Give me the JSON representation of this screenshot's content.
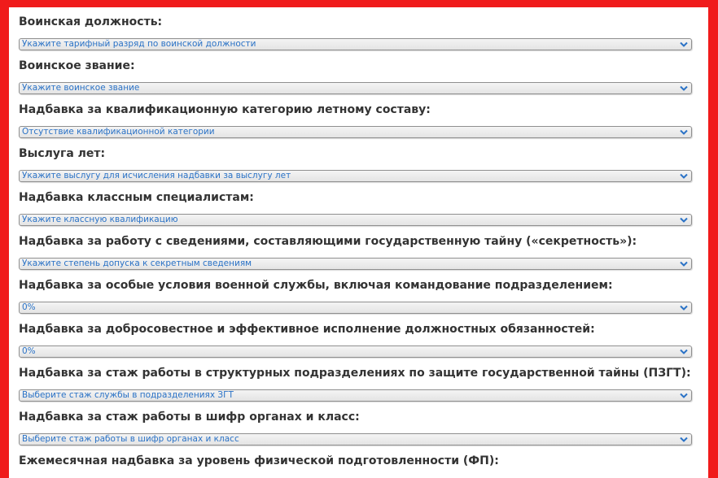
{
  "accent_color": "#f01b1b",
  "value_color": "#2a72c6",
  "fields": [
    {
      "label": "Воинская должность:",
      "value": "Укажите тарифный разряд по воинской должности",
      "icon": "chevron-down-icon"
    },
    {
      "label": "Воинское звание:",
      "value": "Укажите воинское звание",
      "icon": "chevron-down-icon"
    },
    {
      "label": "Надбавка за квалификационную категорию летному составу:",
      "value": "Отсутствие квалификационной категории",
      "icon": "chevron-down-icon"
    },
    {
      "label": "Выслуга лет:",
      "value": "Укажите выслугу для исчисления надбавки за выслугу лет",
      "icon": "chevron-down-icon"
    },
    {
      "label": "Надбавка классным специалистам:",
      "value": "Укажите классную квалификацию",
      "icon": "chevron-down-icon"
    },
    {
      "label": "Надбавка за работу с сведениями, составляющими государственную тайну («секретность»):",
      "value": "Укажите степень допуска к секретным сведениям",
      "icon": "chevron-down-icon"
    },
    {
      "label": "Надбавка за особые условия военной службы, включая командование подразделением:",
      "value": "0%",
      "icon": "chevron-down-icon"
    },
    {
      "label": "Надбавка за добросовестное и эффективное исполнение должностных обязанностей:",
      "value": "0%",
      "icon": "chevron-down-icon"
    },
    {
      "label": "Надбавка за стаж работы в структурных подразделениях по защите государственной тайны (ПЗГТ):",
      "value": "Выберите стаж службы в подразделениях ЗГТ",
      "icon": "chevron-down-icon"
    },
    {
      "label": "Надбавка за стаж работы в шифр органах и класс:",
      "value": "Выберите стаж работы в шифр органах и класс",
      "icon": "chevron-down-icon"
    },
    {
      "label": "Ежемесячная надбавка за уровень физической подготовленности (ФП):"
    }
  ]
}
